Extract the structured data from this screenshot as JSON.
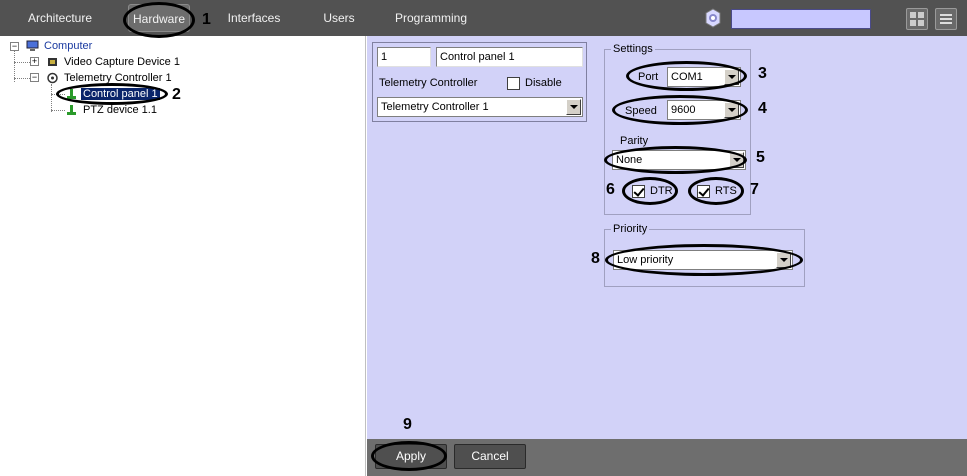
{
  "topbar": {
    "tabs": [
      {
        "label": "Architecture",
        "active": false
      },
      {
        "label": "Hardware",
        "active": true
      },
      {
        "label": "Interfaces",
        "active": false
      },
      {
        "label": "Users",
        "active": false
      },
      {
        "label": "Programming",
        "active": false
      }
    ],
    "search_value": "",
    "icons": [
      "gear-icon",
      "layout-icon",
      "menu-icon"
    ]
  },
  "tree": {
    "items": [
      {
        "label": "Computer",
        "icon": "computer-icon"
      },
      {
        "label": "Video Capture Device 1",
        "icon": "chip-icon"
      },
      {
        "label": "Telemetry Controller 1",
        "icon": "telemetry-icon"
      },
      {
        "label": "Control panel 1",
        "icon": "joystick-icon",
        "selected": true
      },
      {
        "label": "PTZ device 1.1",
        "icon": "joystick-icon"
      }
    ]
  },
  "device": {
    "id_value": "1",
    "name_value": "Control panel 1",
    "type_label": "Telemetry Controller",
    "disable_label": "Disable",
    "disable_checked": false,
    "parent_value": "Telemetry Controller 1"
  },
  "settings": {
    "legend": "Settings",
    "port_label": "Port",
    "port_value": "COM1",
    "speed_label": "Speed",
    "speed_value": "9600",
    "parity_label": "Parity",
    "parity_value": "None",
    "dtr_label": "DTR",
    "dtr_checked": true,
    "rts_label": "RTS",
    "rts_checked": true
  },
  "priority": {
    "legend": "Priority",
    "value": "Low priority"
  },
  "buttons": {
    "apply": "Apply",
    "cancel": "Cancel"
  },
  "callouts": [
    "1",
    "2",
    "3",
    "4",
    "5",
    "6",
    "7",
    "8",
    "9"
  ],
  "colors": {
    "topbar": "#525252",
    "panel": "#d2d2f8",
    "bottombar": "#6e6e6e",
    "selection": "#0a246a",
    "search_box": "#c8c8ff"
  }
}
